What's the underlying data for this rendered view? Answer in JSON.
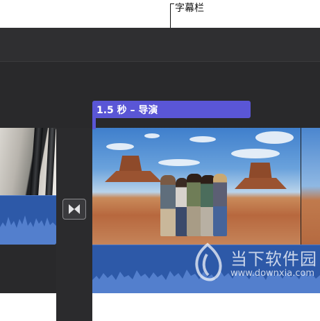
{
  "callout": {
    "label": "字幕栏"
  },
  "title_bar": {
    "label": "1.5 秒 – 导演"
  },
  "transition": {
    "icon": "transition-bowtie-icon"
  },
  "watermark": {
    "name": "当下软件园",
    "url": "www.downxia.com",
    "icon": "leaf-logo-icon"
  },
  "colors": {
    "title_bar": "#5a56d6",
    "audio_track": "#2d59a8",
    "timeline_bg": "#29292b"
  }
}
